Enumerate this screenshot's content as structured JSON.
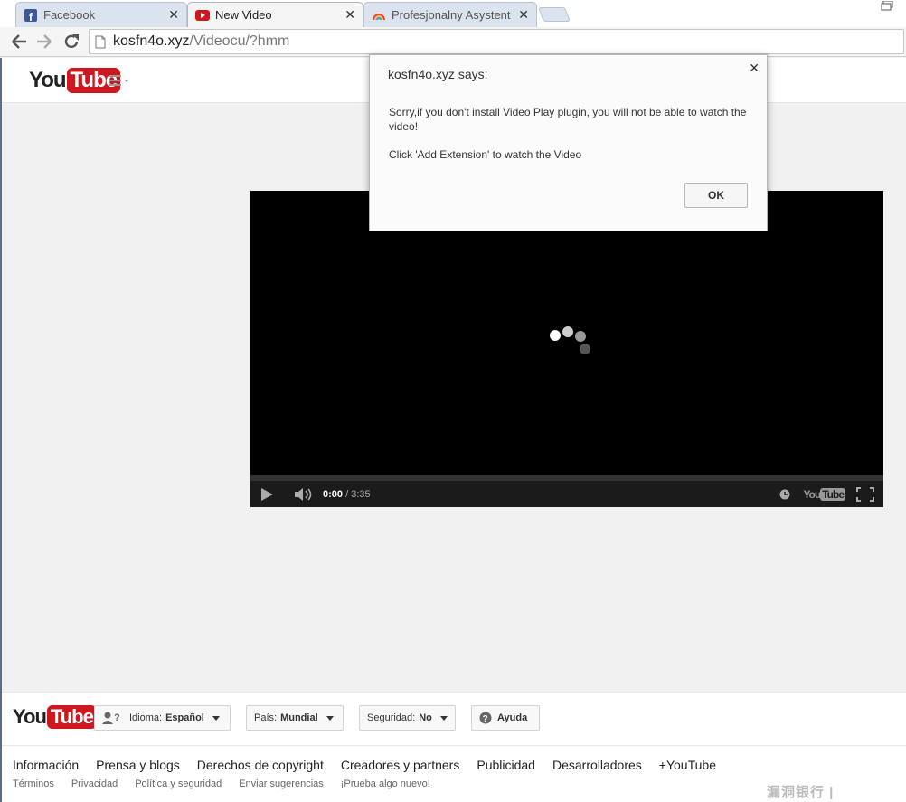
{
  "browser": {
    "tabs": [
      {
        "title": "Facebook",
        "active": false
      },
      {
        "title": "New Video",
        "active": true
      },
      {
        "title": "Profesjonalny Asystent - (",
        "active": false
      }
    ],
    "url_host": "kosfn4o.xyz",
    "url_path": "/Videocu/?hmm"
  },
  "brand": {
    "you": "You",
    "tube": "Tube"
  },
  "dialog": {
    "title": "kosfn4o.xyz says:",
    "message": "Sorry,if you don't install Video Play plugin, you will not be able to watch the video!",
    "instruction": "Click 'Add Extension' to watch the Video",
    "ok_label": "OK"
  },
  "player": {
    "current_time": "0:00",
    "separator": "/",
    "total_time": "3:35",
    "progress": 0
  },
  "footer": {
    "language_label": "Idioma:",
    "language_value": "Español",
    "country_label": "País:",
    "country_value": "Mundial",
    "safety_label": "Seguridad:",
    "safety_value": "No",
    "help_label": "Ayuda",
    "links": [
      "Información",
      "Prensa y blogs",
      "Derechos de copyright",
      "Creadores y partners",
      "Publicidad",
      "Desarrolladores",
      "+YouTube"
    ],
    "sublinks": [
      "Términos",
      "Privacidad",
      "Política y seguridad",
      "Enviar sugerencias",
      "¡Prueba algo nuevo!"
    ]
  },
  "watermark": "漏洞银行 | BUGBANK",
  "colors": {
    "youtube_red": "#cc181e",
    "player_bg": "#000000",
    "facebook_blue": "#3b5998"
  }
}
